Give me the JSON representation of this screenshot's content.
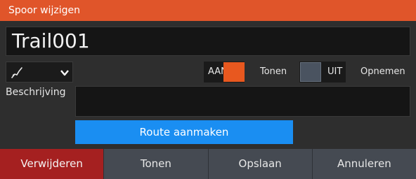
{
  "dialog": {
    "title": "Spoor wijzigen"
  },
  "name_field": {
    "value": "Trail001"
  },
  "track_icon": {
    "icon": "track-line-icon",
    "dropdown_icon": "chevron-down-icon"
  },
  "show_toggle": {
    "state_label": "AAN",
    "caption": "Tonen",
    "color": "#e8581f"
  },
  "record_toggle": {
    "state_label": "UIT",
    "caption": "Opnemen",
    "color": "#4a5360"
  },
  "description": {
    "label": "Beschrijving",
    "value": ""
  },
  "route_button": {
    "label": "Route aanmaken",
    "color": "#1a8ef2"
  },
  "bottom_buttons": [
    {
      "label": "Verwijderen",
      "color": "#a52020"
    },
    {
      "label": "Tonen"
    },
    {
      "label": "Opslaan"
    },
    {
      "label": "Annuleren"
    }
  ]
}
